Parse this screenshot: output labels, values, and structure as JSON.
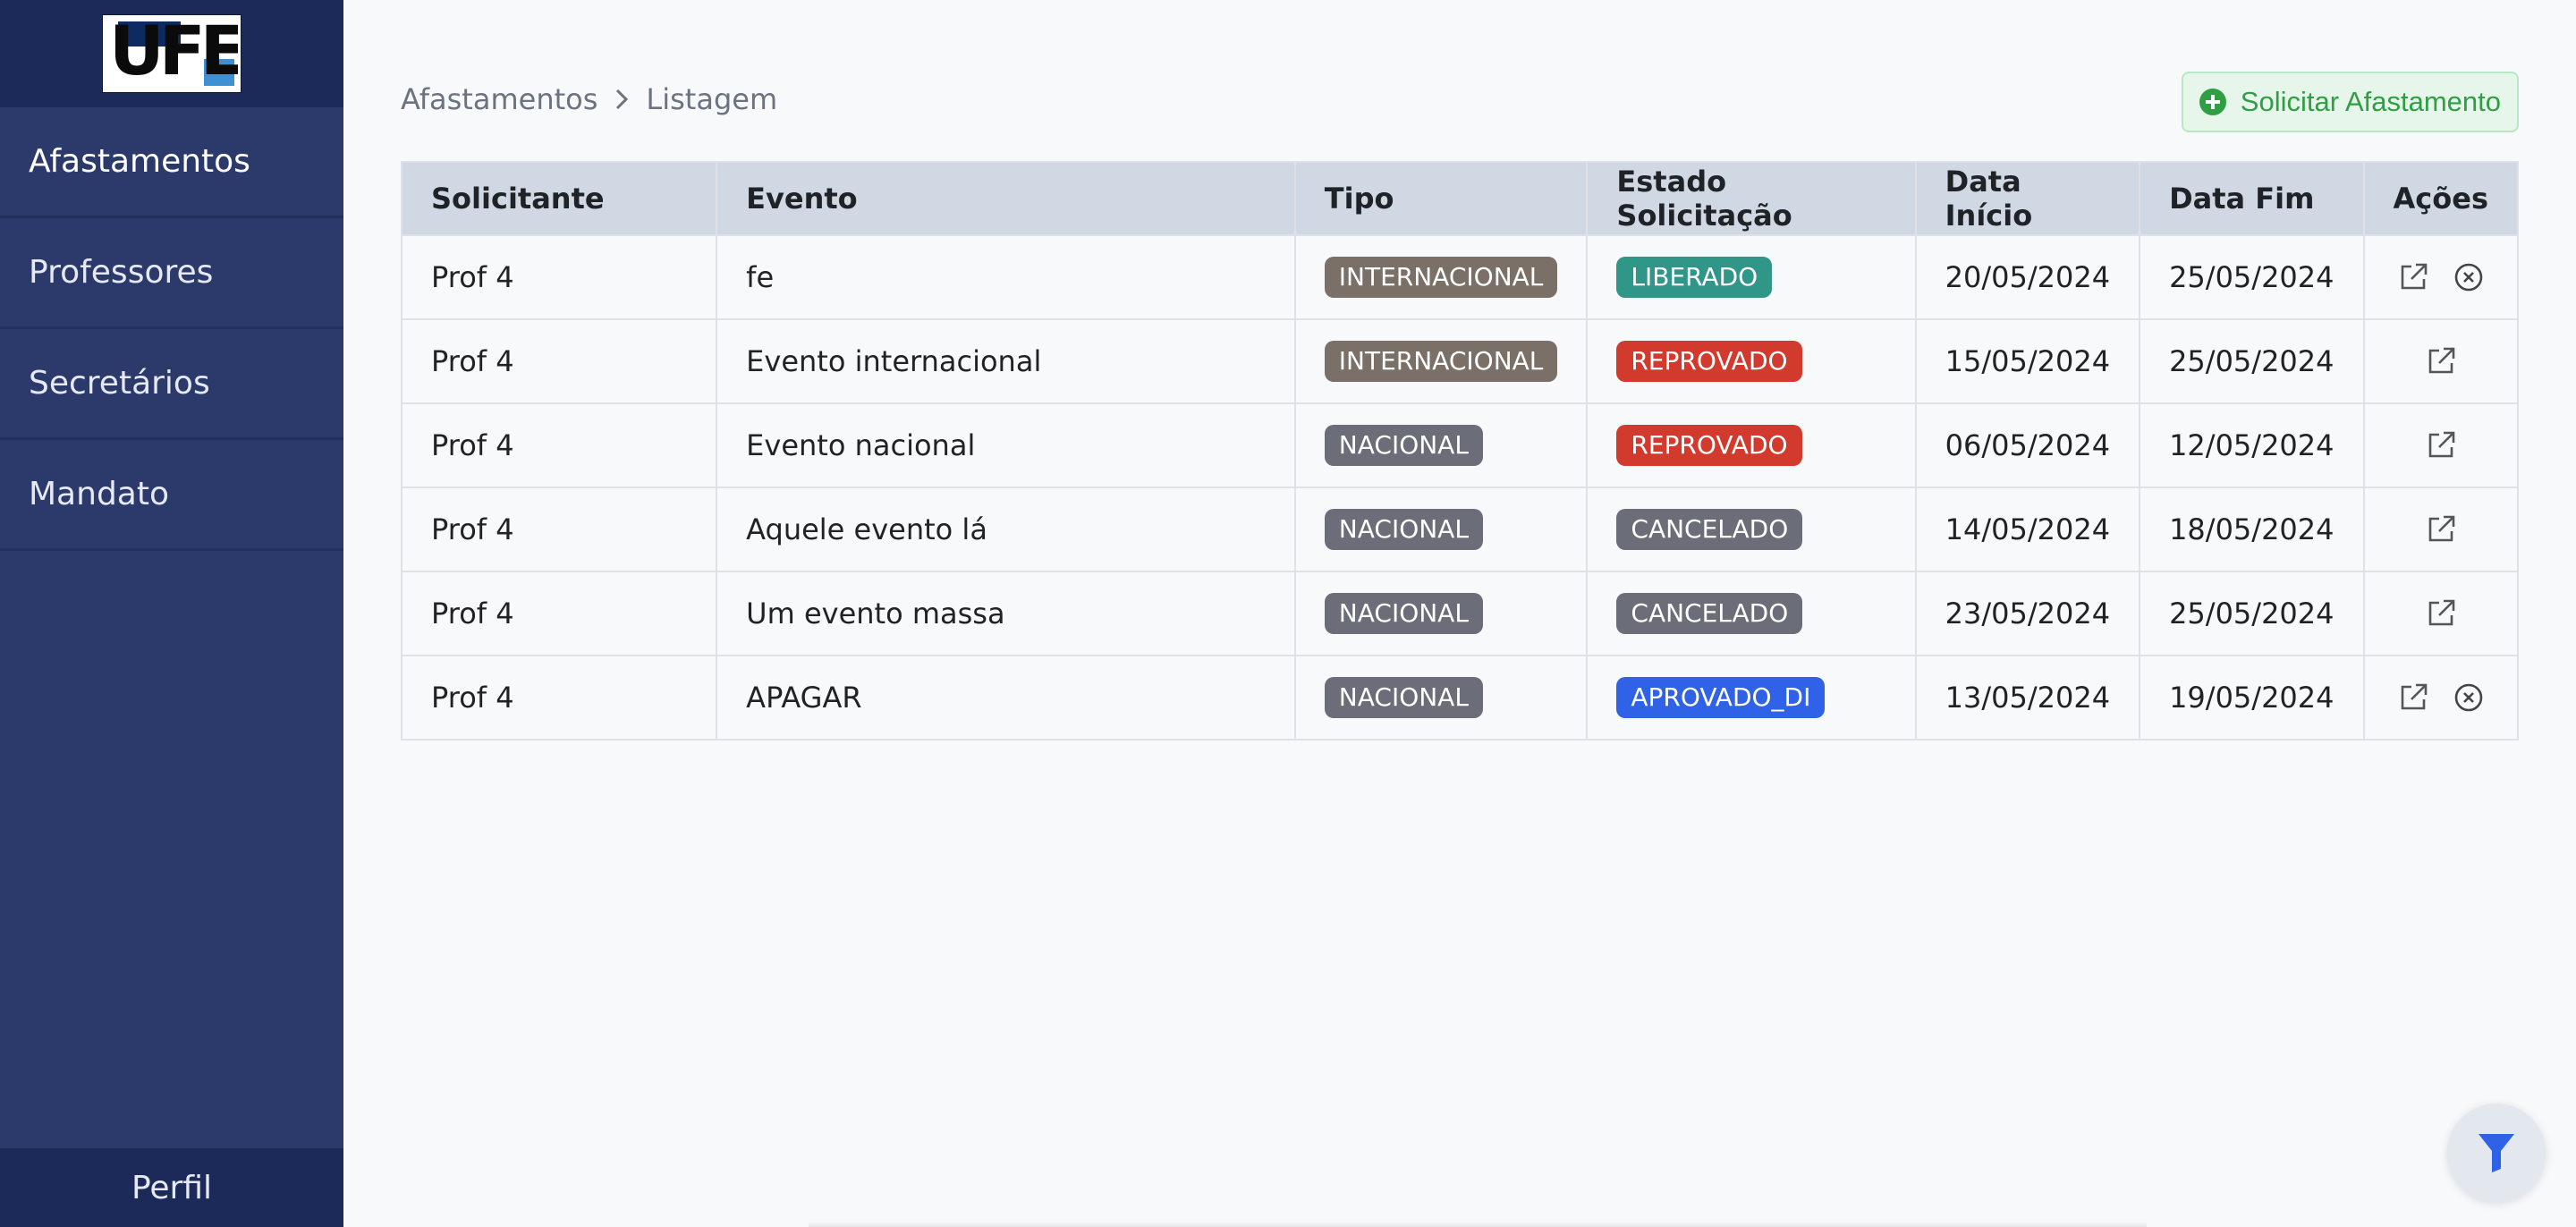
{
  "brand": {
    "logo_alt": "UFES"
  },
  "sidebar": {
    "items": [
      {
        "label": "Afastamentos"
      },
      {
        "label": "Professores"
      },
      {
        "label": "Secretários"
      },
      {
        "label": "Mandato"
      }
    ],
    "profile_label": "Perfil"
  },
  "breadcrumb": {
    "root": "Afastamentos",
    "current": "Listagem"
  },
  "actions": {
    "request_label": "Solicitar Afastamento"
  },
  "table": {
    "headers": {
      "solicitante": "Solicitante",
      "evento": "Evento",
      "tipo": "Tipo",
      "estado": "Estado Solicitação",
      "data_inicio": "Data Início",
      "data_fim": "Data Fim",
      "acoes": "Ações"
    },
    "rows": [
      {
        "solicitante": "Prof 4",
        "evento": "fe",
        "tipo": "INTERNACIONAL",
        "estado": "LIBERADO",
        "data_inicio": "20/05/2024",
        "data_fim": "25/05/2024",
        "cancel": true
      },
      {
        "solicitante": "Prof 4",
        "evento": "Evento internacional",
        "tipo": "INTERNACIONAL",
        "estado": "REPROVADO",
        "data_inicio": "15/05/2024",
        "data_fim": "25/05/2024",
        "cancel": false
      },
      {
        "solicitante": "Prof 4",
        "evento": "Evento nacional",
        "tipo": "NACIONAL",
        "estado": "REPROVADO",
        "data_inicio": "06/05/2024",
        "data_fim": "12/05/2024",
        "cancel": false
      },
      {
        "solicitante": "Prof 4",
        "evento": "Aquele evento lá",
        "tipo": "NACIONAL",
        "estado": "CANCELADO",
        "data_inicio": "14/05/2024",
        "data_fim": "18/05/2024",
        "cancel": false
      },
      {
        "solicitante": "Prof 4",
        "evento": "Um evento massa",
        "tipo": "NACIONAL",
        "estado": "CANCELADO",
        "data_inicio": "23/05/2024",
        "data_fim": "25/05/2024",
        "cancel": false
      },
      {
        "solicitante": "Prof 4",
        "evento": "APAGAR",
        "tipo": "NACIONAL",
        "estado": "APROVADO_DI",
        "data_inicio": "13/05/2024",
        "data_fim": "19/05/2024",
        "cancel": true
      }
    ]
  },
  "colors": {
    "sidebar_bg": "#2b3a6b",
    "sidebar_dark": "#1c2a59",
    "tipo_internacional": "#7a7068",
    "tipo_nacional": "#6b6e78",
    "estado_liberado": "#2f9688",
    "estado_reprovado": "#d23a2e",
    "estado_cancelado": "#6b6e78",
    "estado_aprovado_di": "#2f62e6",
    "accent_green": "#2f9e44",
    "filter_blue": "#2f62e6"
  },
  "icons": {
    "edit": "external-link-icon",
    "cancel": "close-circle-icon",
    "filter": "filter-icon",
    "add": "plus-circle-icon"
  }
}
